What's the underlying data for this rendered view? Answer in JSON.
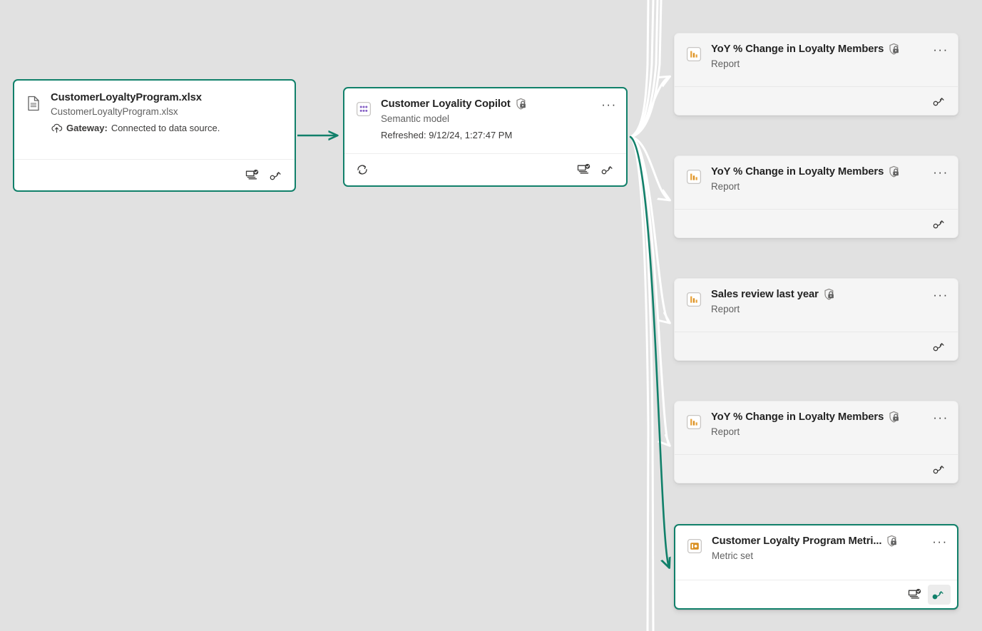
{
  "canvas": {
    "background_color": "#e1e1e1",
    "accent_color": "#11806a",
    "edge_color": "#ffffff"
  },
  "nodes": {
    "source": {
      "id": "card-xlsx",
      "title": "CustomerLoyaltyProgram.xlsx",
      "subtitle": "CustomerLoyaltyProgram.xlsx",
      "meta_label": "Gateway:",
      "meta_value": "Connected to data source.",
      "icon": "file-icon",
      "gateway_icon": "cloud-upload-icon",
      "selected": true,
      "footer_icons": [
        "impact-analysis-icon",
        "lineage-icon"
      ]
    },
    "semantic_model": {
      "id": "card-semantic",
      "title": "Customer Loyality Copilot",
      "subtitle": "Semantic model",
      "meta": "Refreshed: 9/12/24, 1:27:47 PM",
      "icon": "semantic-model-icon",
      "sensitivity_icon": "shield-lock-icon",
      "more_label": "···",
      "selected": true,
      "footer_icons": [
        "refresh-icon",
        "impact-analysis-icon",
        "lineage-icon"
      ]
    },
    "downstream": [
      {
        "id": "card-r1",
        "title": "YoY % Change in Loyalty Members",
        "subtitle": "Report",
        "icon": "report-icon",
        "sensitivity_icon": "shield-lock-icon",
        "more_label": "···",
        "selected": false,
        "footer_icons": [
          "lineage-icon"
        ],
        "highlight_lineage": false
      },
      {
        "id": "card-r2",
        "title": "YoY % Change in Loyalty Members",
        "subtitle": "Report",
        "icon": "report-icon",
        "sensitivity_icon": "shield-lock-icon",
        "more_label": "···",
        "selected": false,
        "footer_icons": [
          "lineage-icon"
        ],
        "highlight_lineage": false
      },
      {
        "id": "card-r3",
        "title": "Sales review last year",
        "subtitle": "Report",
        "icon": "report-icon",
        "sensitivity_icon": "shield-lock-icon",
        "more_label": "···",
        "selected": false,
        "footer_icons": [
          "lineage-icon"
        ],
        "highlight_lineage": false
      },
      {
        "id": "card-r4",
        "title": "YoY % Change in Loyalty Members",
        "subtitle": "Report",
        "icon": "report-icon",
        "sensitivity_icon": "shield-lock-icon",
        "more_label": "···",
        "selected": false,
        "footer_icons": [
          "lineage-icon"
        ],
        "highlight_lineage": false
      },
      {
        "id": "card-m1",
        "title": "Customer Loyalty Program Metri...",
        "subtitle": "Metric set",
        "icon": "metric-set-icon",
        "sensitivity_icon": "shield-lock-icon",
        "more_label": "···",
        "selected": true,
        "footer_icons": [
          "impact-analysis-icon",
          "lineage-icon"
        ],
        "highlight_lineage": true
      }
    ]
  }
}
